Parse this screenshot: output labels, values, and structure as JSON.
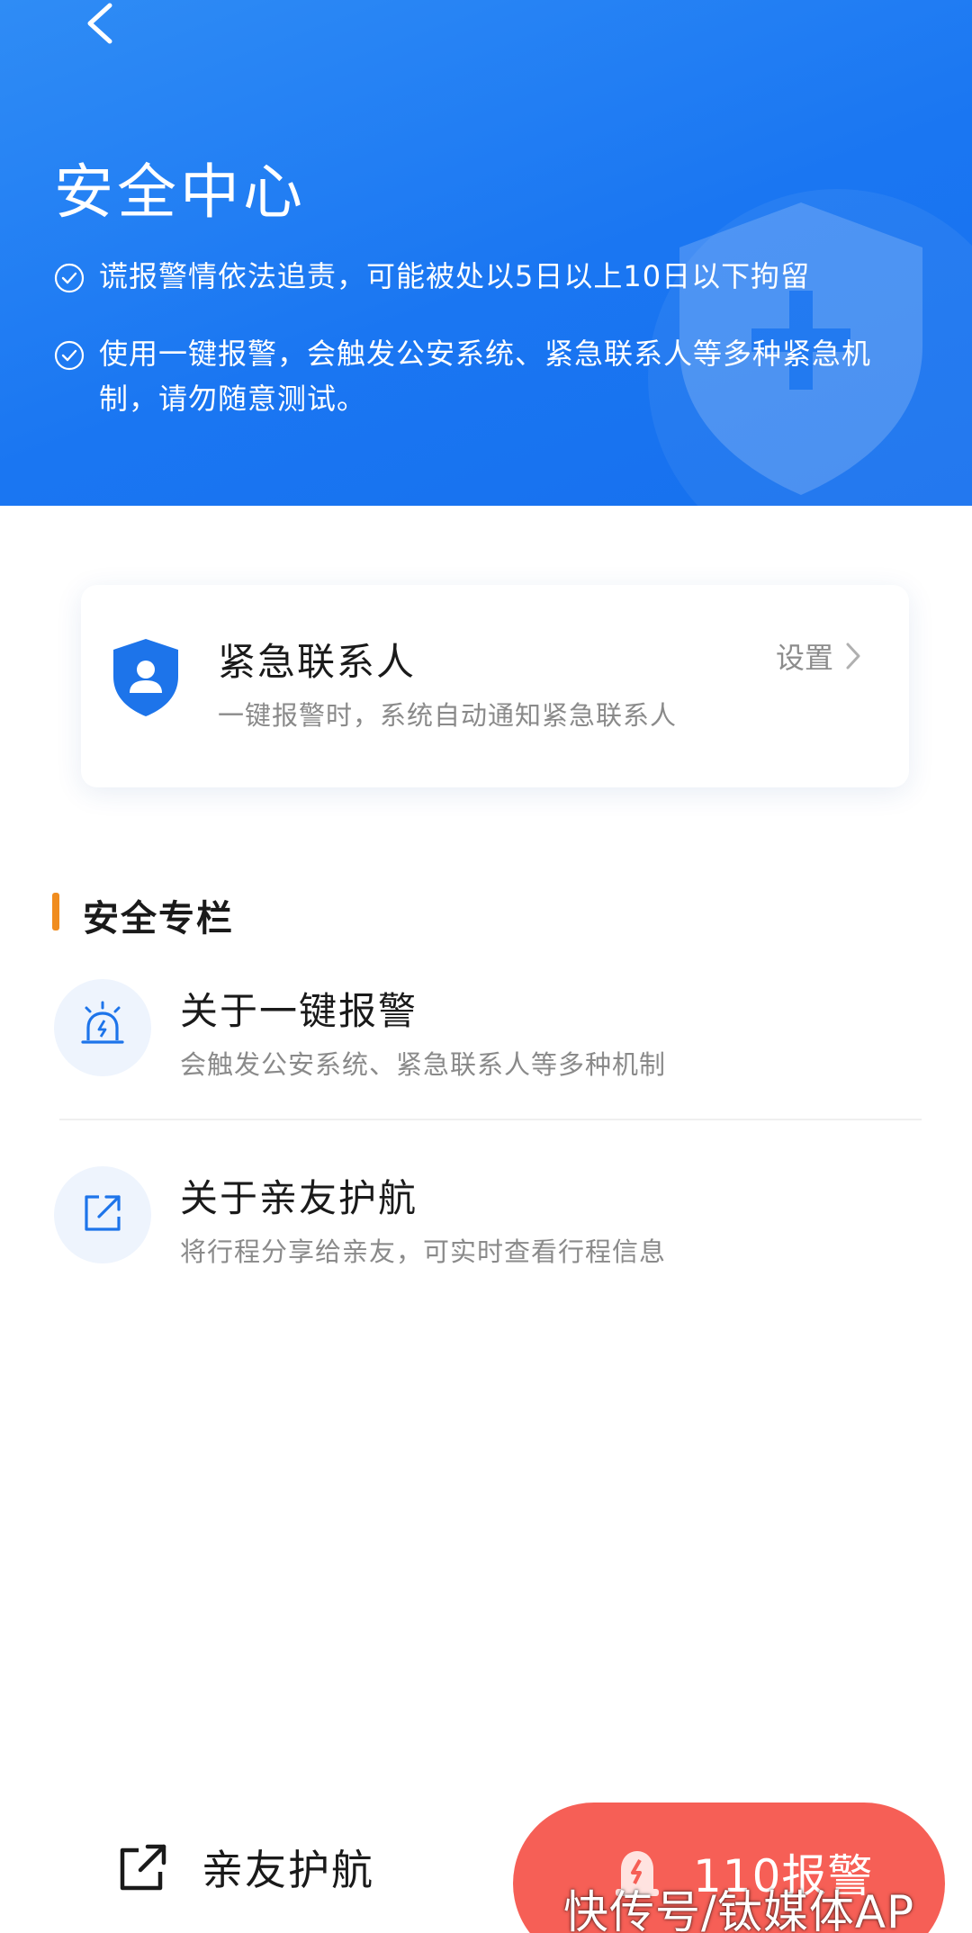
{
  "header": {
    "title": "安全中心",
    "notices": [
      "谎报警情依法追责，可能被处以5日以上10日以下拘留",
      "使用一键报警，会触发公安系统、紧急联系人等多种紧急机制，请勿随意测试。"
    ],
    "colors": {
      "gradient_start": "#2f8cf5",
      "gradient_end": "#1670ee"
    }
  },
  "emergency_contact": {
    "title": "紧急联系人",
    "subtitle": "一键报警时，系统自动通知紧急联系人",
    "action_label": "设置"
  },
  "safety_column": {
    "title": "安全专栏",
    "items": [
      {
        "title": "关于一键报警",
        "subtitle": "会触发公安系统、紧急联系人等多种机制",
        "icon": "alarm-light-icon"
      },
      {
        "title": "关于亲友护航",
        "subtitle": "将行程分享给亲友，可实时查看行程信息",
        "icon": "share-icon"
      }
    ]
  },
  "bottom_bar": {
    "share_label": "亲友护航",
    "alarm_label": "110报警",
    "alarm_color": "#f65f56"
  },
  "watermark": "快传号/钛媒体AP"
}
